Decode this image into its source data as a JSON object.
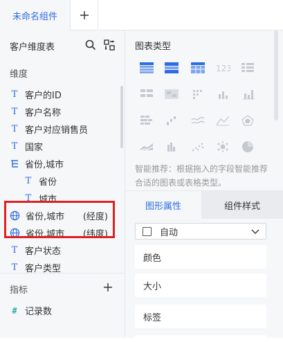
{
  "tabs": {
    "active_label": "未命名组件",
    "add_label": "+"
  },
  "left_panel": {
    "title": "客户维度表",
    "dimension_label": "维度",
    "measure_label": "指标",
    "dimensions": [
      {
        "type": "T",
        "name": "客户的ID",
        "indent": 0
      },
      {
        "type": "T",
        "name": "客户名称",
        "indent": 0
      },
      {
        "type": "T",
        "name": "客户对应销售员",
        "indent": 0
      },
      {
        "type": "T",
        "name": "国家",
        "indent": 0
      },
      {
        "type": "tree",
        "name": "省份,城市",
        "indent": 0
      },
      {
        "type": "T",
        "name": "省份",
        "indent": 1
      },
      {
        "type": "T",
        "name": "城市",
        "indent": 1
      },
      {
        "type": "geo",
        "name": "省份,城市",
        "suffix": "(经度)",
        "indent": 0
      },
      {
        "type": "geo",
        "name": "省份,城市",
        "suffix": "(纬度)",
        "indent": 0
      },
      {
        "type": "T",
        "name": "客户状态",
        "indent": 0
      },
      {
        "type": "T",
        "name": "客户类型",
        "indent": 0
      }
    ],
    "measures": [
      {
        "type": "#",
        "name": "记录数"
      }
    ]
  },
  "right_panel": {
    "chart_type_title": "图表类型",
    "hint": "智能推荐：根据拖入的字段智能推荐合适的图表或表格类型。",
    "tab_active": "图形属性",
    "tab_inactive": "组件样式",
    "select_value": "自动",
    "properties": [
      "颜色",
      "大小",
      "标签"
    ]
  },
  "colors": {
    "accent": "#2d6ce5",
    "highlight": "#e02020",
    "icon_disabled": "#c4c8cf"
  }
}
